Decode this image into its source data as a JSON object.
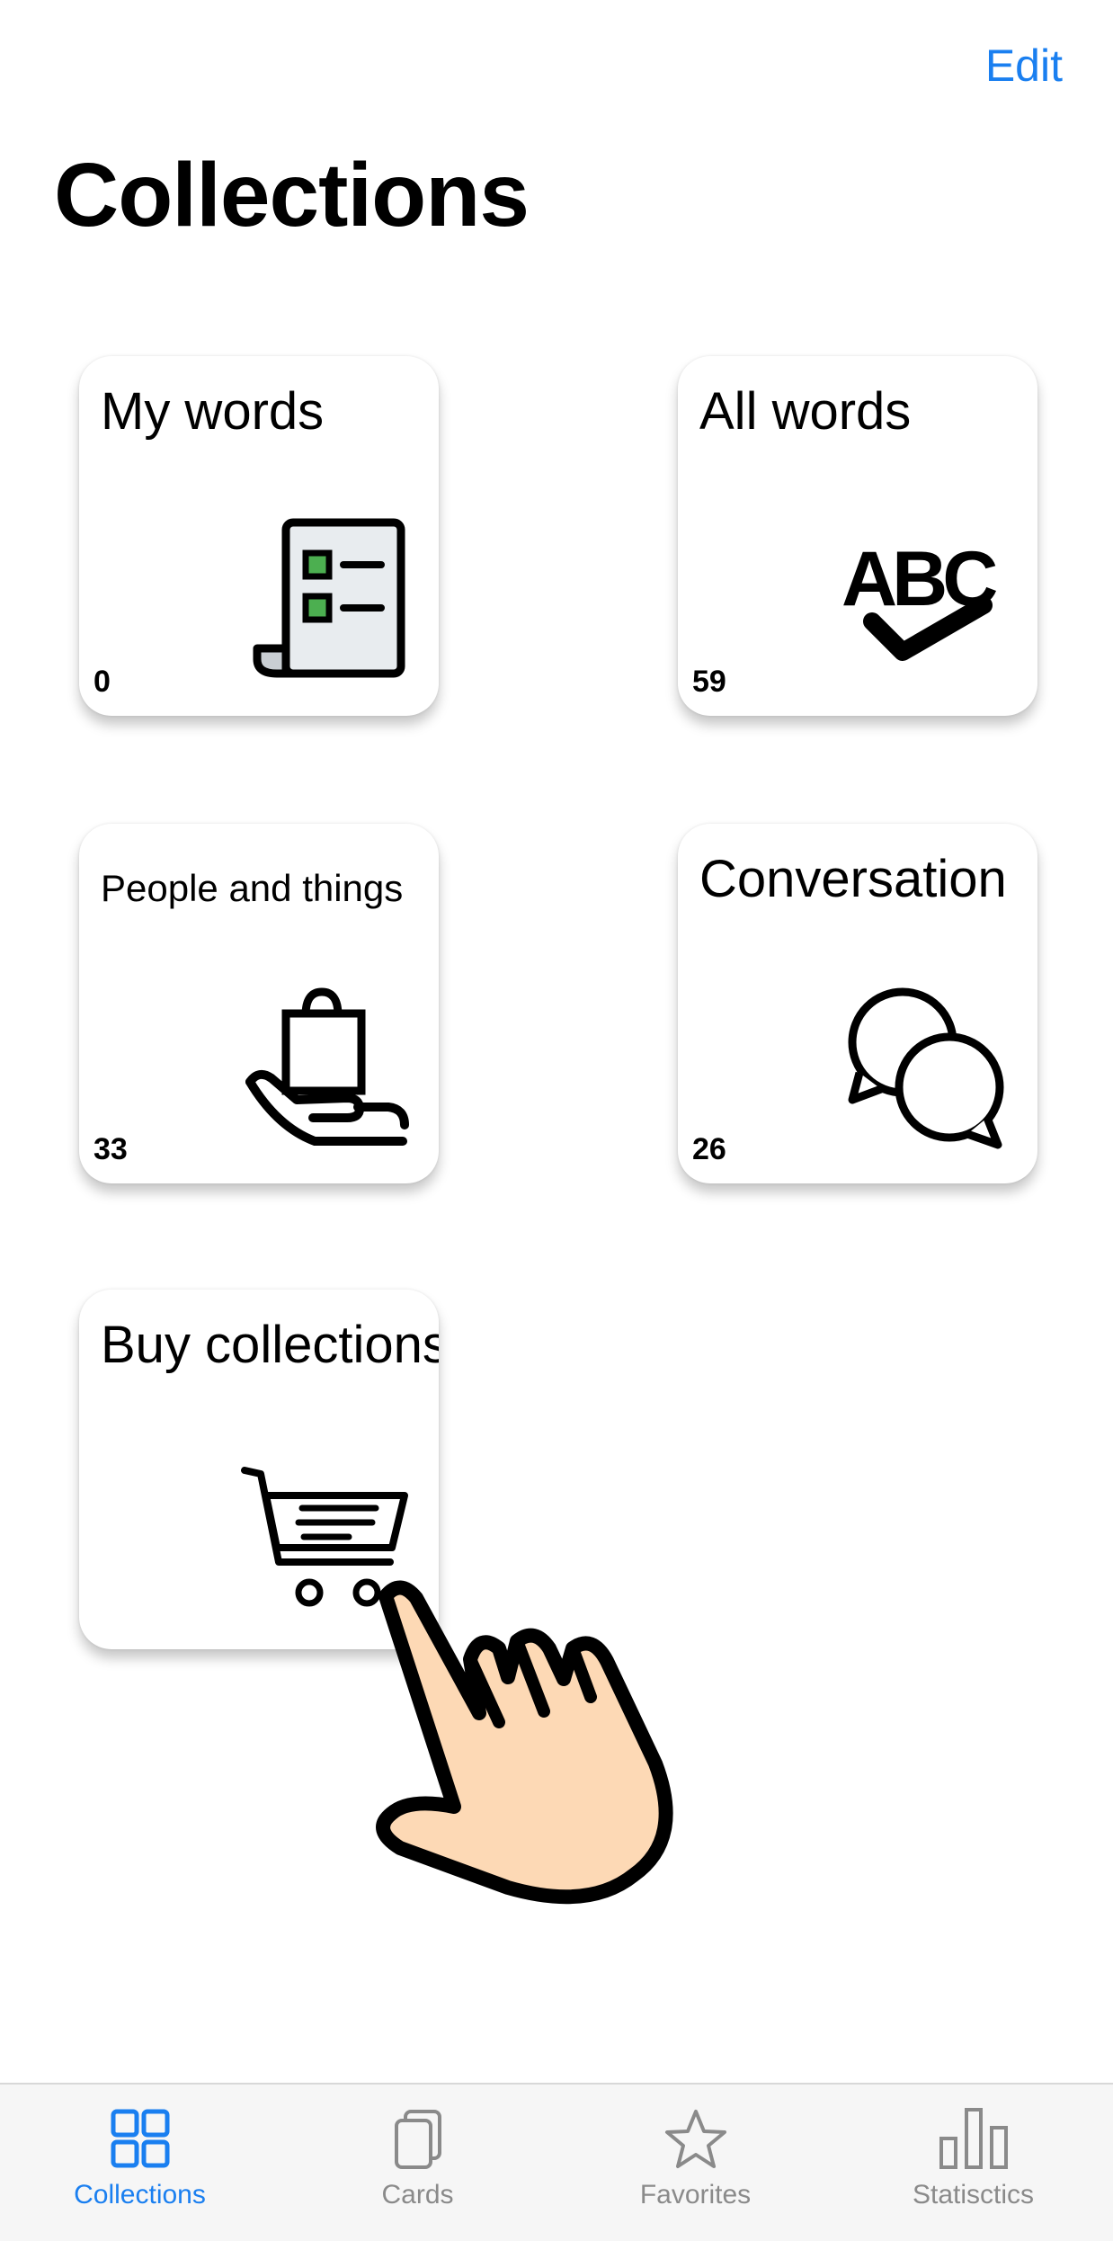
{
  "header": {
    "edit_label": "Edit",
    "title": "Collections"
  },
  "collections": [
    {
      "title": "My words",
      "count": "0",
      "icon": "document-checklist-icon"
    },
    {
      "title": "All words",
      "count": "59",
      "icon": "abc-check-icon"
    },
    {
      "title": "People and things",
      "count": "33",
      "icon": "hand-bag-icon"
    },
    {
      "title": "Conversation",
      "count": "26",
      "icon": "speech-bubbles-icon"
    },
    {
      "title": "Buy collections",
      "icon": "shopping-cart-icon"
    }
  ],
  "tabbar": {
    "items": [
      {
        "label": "Collections",
        "icon": "grid-icon",
        "active": true
      },
      {
        "label": "Cards",
        "icon": "cards-icon"
      },
      {
        "label": "Favorites",
        "icon": "star-icon"
      },
      {
        "label": "Statisctics",
        "icon": "bar-chart-icon"
      }
    ]
  },
  "colors": {
    "accent": "#1a7ff0",
    "inactive": "#8a8a8a",
    "icon_green": "#4caf50",
    "hand_skin": "#fdd9b5"
  }
}
